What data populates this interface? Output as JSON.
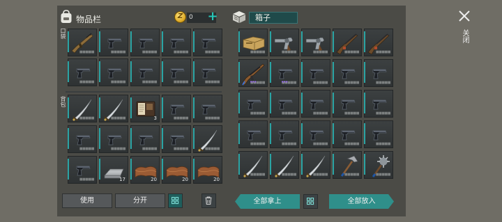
{
  "header": {
    "inventory_title": "物品栏",
    "coin_symbol": "Z",
    "coin_count": "0",
    "plus_label": "+",
    "box_title": "箱子",
    "close_label": "关闭"
  },
  "sections": {
    "pocket_label": "口袋",
    "backpack_label": "背包"
  },
  "inventory": {
    "pocket": [
      {
        "item": "rifle-icon",
        "count": ""
      },
      {
        "item": "pistol-icon",
        "count": ""
      },
      {
        "item": "pistol-icon",
        "count": ""
      },
      {
        "item": "pistol-icon",
        "count": ""
      },
      {
        "item": "pistol-icon",
        "count": ""
      },
      {
        "item": "pistol-icon",
        "count": ""
      },
      {
        "item": "pistol-icon",
        "count": ""
      },
      {
        "item": "pistol-icon",
        "count": ""
      },
      {
        "item": "pistol-icon",
        "count": ""
      },
      {
        "item": "pistol-icon",
        "count": ""
      }
    ],
    "backpack": [
      {
        "item": "sword-icon",
        "count": ""
      },
      {
        "item": "sword-icon",
        "count": ""
      },
      {
        "item": "notebook-icon",
        "count": "3"
      },
      {
        "item": "pistol-icon",
        "count": ""
      },
      {
        "item": "pistol-icon",
        "count": ""
      },
      {
        "item": "pistol-icon",
        "count": ""
      },
      {
        "item": "pistol-icon",
        "count": ""
      },
      {
        "item": "pistol-icon",
        "count": ""
      },
      {
        "item": "pistol-icon",
        "count": ""
      },
      {
        "item": "sword-icon",
        "count": ""
      },
      {
        "item": "pistol-icon",
        "count": ""
      },
      {
        "item": "metal-bar-icon",
        "count": "17"
      },
      {
        "item": "leather-icon",
        "count": "20"
      },
      {
        "item": "leather-icon",
        "count": "20"
      },
      {
        "item": "leather-icon",
        "count": "20"
      }
    ]
  },
  "box": {
    "items": [
      {
        "item": "ammo-crate-icon",
        "count": ""
      },
      {
        "item": "revolver-icon",
        "count": ""
      },
      {
        "item": "revolver-icon",
        "count": ""
      },
      {
        "item": "shotgun-icon",
        "count": ""
      },
      {
        "item": "shotgun-icon",
        "count": ""
      },
      {
        "item": "assault-rifle-icon",
        "count": ""
      },
      {
        "item": "pistol-icon",
        "count": ""
      },
      {
        "item": "pistol-icon",
        "count": ""
      },
      {
        "item": "pistol-icon",
        "count": ""
      },
      {
        "item": "pistol-icon",
        "count": ""
      },
      {
        "item": "pistol-icon",
        "count": ""
      },
      {
        "item": "pistol-icon",
        "count": ""
      },
      {
        "item": "pistol-icon",
        "count": ""
      },
      {
        "item": "pistol-icon",
        "count": ""
      },
      {
        "item": "pistol-icon",
        "count": ""
      },
      {
        "item": "pistol-icon",
        "count": ""
      },
      {
        "item": "pistol-icon",
        "count": ""
      },
      {
        "item": "pistol-icon",
        "count": ""
      },
      {
        "item": "pistol-icon",
        "count": ""
      },
      {
        "item": "pistol-icon",
        "count": ""
      },
      {
        "item": "sword-icon",
        "count": ""
      },
      {
        "item": "sword-icon",
        "count": ""
      },
      {
        "item": "sword-icon",
        "count": ""
      },
      {
        "item": "hammer-icon",
        "count": ""
      },
      {
        "item": "spiked-mace-icon",
        "count": ""
      }
    ],
    "purple_tags": [
      "•••",
      "•••"
    ]
  },
  "buttons": {
    "use": "使用",
    "split": "分开",
    "take_all": "全部拿上",
    "put_all": "全部放入"
  },
  "colors": {
    "accent": "#2f8f8a",
    "slot_bar": "#2aa3a3",
    "rare_dots": "#a06cff"
  }
}
